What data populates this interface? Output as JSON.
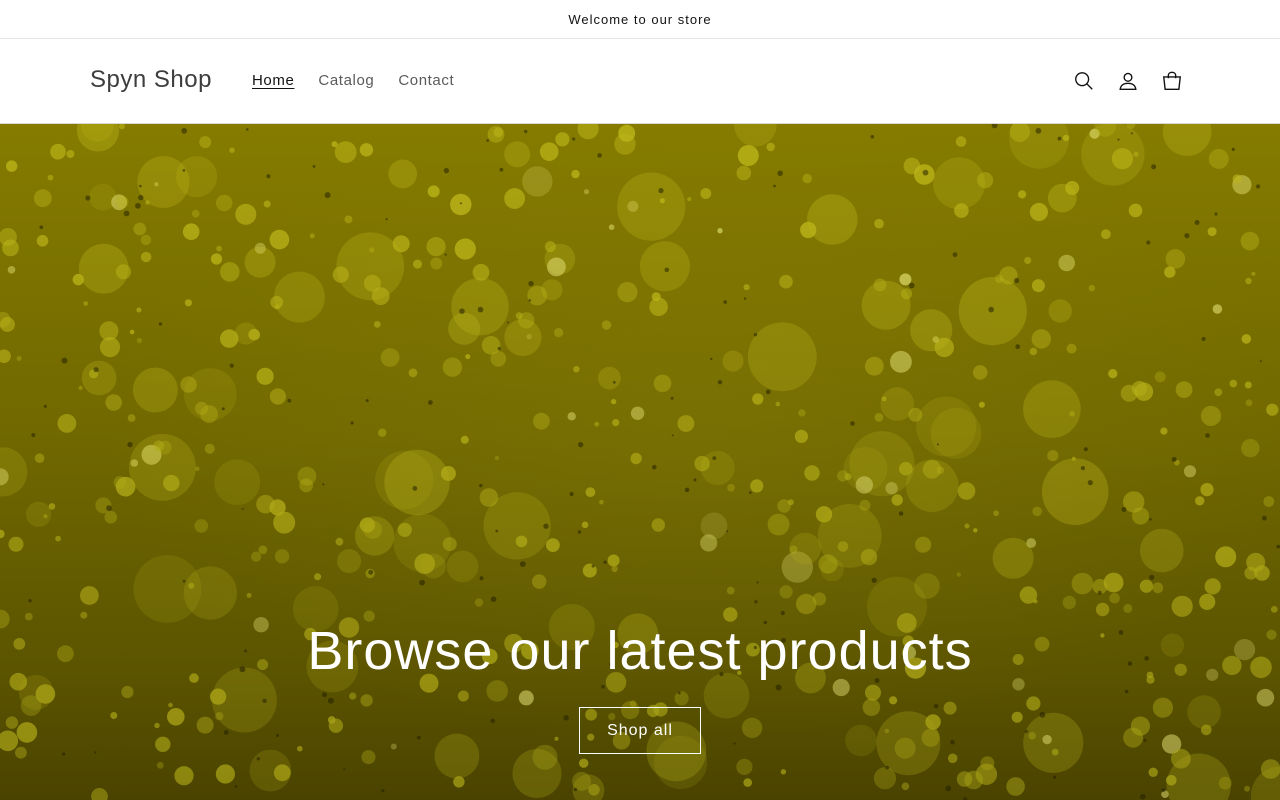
{
  "announcement": {
    "text": "Welcome to our store"
  },
  "header": {
    "logo": "Spyn Shop",
    "nav": [
      {
        "label": "Home",
        "active": true
      },
      {
        "label": "Catalog",
        "active": false
      },
      {
        "label": "Contact",
        "active": false
      }
    ],
    "icons": [
      "search-icon",
      "account-icon",
      "cart-icon"
    ]
  },
  "hero": {
    "title": "Browse our latest products",
    "button_label": "Shop all",
    "image": "yellow-green liquid with bubbles",
    "colors": {
      "base": "#7f7500",
      "bubble": "#c9c21a",
      "highlight": "#e7e26a"
    }
  }
}
